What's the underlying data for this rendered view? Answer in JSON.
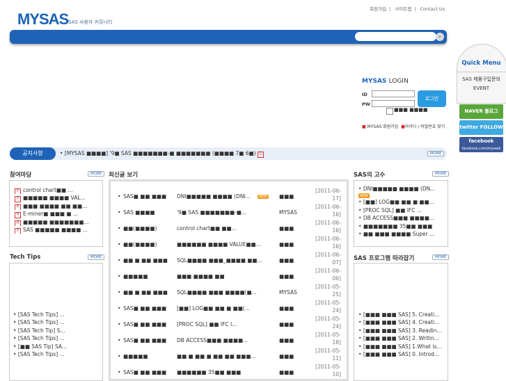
{
  "header": {
    "top_links": [
      "회원가입",
      "사이트맵",
      "Contact Us"
    ],
    "logo": "MYSAS",
    "logo_sub": "SAS 사용자 커뮤니티",
    "search_placeholder": ""
  },
  "login": {
    "title_brand": "MYSAS",
    "title_rest": "LOGIN",
    "id_label": "ID",
    "pw_label": "PW",
    "button": "로그인",
    "remember": "■■■ ■■■■",
    "link_join": "MYSAS 회원가입",
    "link_find": "아이디 / 비밀번호 찾기"
  },
  "quick_menu": {
    "title": "Quick Menu",
    "item1": "SAS 제품구입문의",
    "item2": "EVENT",
    "naver": "NAVER 블로그",
    "twitter": "twitter FOLLOW ME",
    "facebook": "facebook",
    "facebook_url": "facebook.com/mysask"
  },
  "notice": {
    "label": "공지사항",
    "text": "[MYSAS ■■■■] '9■ SAS ■■■■■■■-■ ■■■■■■■ (■■■■ 7■ 6■)",
    "more": "MORE"
  },
  "participation": {
    "title": "참여마당",
    "more": "MORE",
    "items": [
      "control chart■■ ...",
      "■■■■■ ■■■■ VAL...",
      "■■■ ■■■■ ■■ ■■...",
      "E-miner■ ■■■ ■ ...",
      "■■■■■ ■■■■■■■...",
      "SAS ■■■■■ ■■■■ ..."
    ]
  },
  "techtips": {
    "title": "Tech Tips",
    "more": "MORE",
    "items": [
      "[SAS Tech Tips] ...",
      "[SAS Tech Tips] ...",
      "[SAS Tech Tip] S...",
      "[SAS Tech Tips] ...",
      "[■■ SAS Tip] SA...",
      "[SAS Tech Tips] ..."
    ]
  },
  "latest": {
    "title": "최신글 보기",
    "rows": [
      {
        "cat": "SAS■ ■■ ■■■",
        "subject": "DNI■■■■■ ■■■■ (DNI...",
        "author": "■■■",
        "date": "[2011-06-17]",
        "new": true
      },
      {
        "cat": "SAS ■■■■",
        "subject": "'9■ SAS ■■■■■■■-■...",
        "author": "MYSAS",
        "date": "[2011-06-16]",
        "new": false
      },
      {
        "cat": "■■(■■■■)",
        "subject": "control chart■■ ■■...",
        "author": "■■■",
        "date": "[2011-06-16]",
        "new": false
      },
      {
        "cat": "■■(■■■■)",
        "subject": "■■■■■■ ■■■■ VALUE■■...",
        "author": "■■■",
        "date": "[2011-06-16]",
        "new": false
      },
      {
        "cat": "■■ ■ ■■ ■■■",
        "subject": "SQL■■■■ ■■■_■■■■ ■■...",
        "author": "■■■",
        "date": "[2011-06-07]",
        "new": false
      },
      {
        "cat": "■■■■■",
        "subject": "■■■ ■■■■ ■■",
        "author": "■■■",
        "date": "[2011-06-06]",
        "new": false
      },
      {
        "cat": "■■ ■ ■■ ■■■",
        "subject": "SQL■■■■ ■■■ ■■■■(■...",
        "author": "MYSAS",
        "date": "[2011-05-25]",
        "new": false
      },
      {
        "cat": "SAS■ ■■ ■■■",
        "subject": "[■■] LOG■■ ■■ ■ ■■(...",
        "author": "■■■",
        "date": "[2011-05-24]",
        "new": false
      },
      {
        "cat": "SAS■ ■■ ■■■",
        "subject": "[PROC SQL] ■■ IFC I...",
        "author": "■■■",
        "date": "[2011-05-24]",
        "new": false
      },
      {
        "cat": "SAS■ ■■ ■■■",
        "subject": "DB ACCESS■■■ ■■■■...",
        "author": "■■■",
        "date": "[2011-05-18]",
        "new": false
      },
      {
        "cat": "■■■■■",
        "subject": "■■ ■ ■■ ■ ■■ ■■ ■■■...",
        "author": "■■■",
        "date": "[2011-05-11]",
        "new": false
      },
      {
        "cat": "SAS■ ■■ ■■■",
        "subject": "■■■■■■ 35■■ ■■■",
        "author": "■■■",
        "date": "[2011-05-10]",
        "new": false
      }
    ]
  },
  "masters": {
    "title": "SAS의 고수",
    "more": "MORE",
    "items": [
      "DNI■■■■■ ■■■■ (DN...",
      "[■■] LOG■■ ■■ ■ ■■...",
      "[PROC SQL] ■■ IFC ...",
      "DB ACCESS■■■ ■■■■...",
      "■■■■■■■ 35■■ ■■■",
      "■■ ■■■ ■■■■ Super ..."
    ]
  },
  "program": {
    "title": "SAS 프로그램 따라잡기",
    "more": "MORE",
    "items": [
      "[■■■ ■■■ SAS] 5. Creati...",
      "[■■■ ■■■ SAS] 4. Creati...",
      "[■■■ ■■■ SAS] 3. Readin...",
      "[■■■ ■■■ SAS] 2. Writin...",
      "[■■■ ■■■ SAS] 1.What is...",
      "[■■■ ■■■ SAS] 0. Introd..."
    ]
  }
}
